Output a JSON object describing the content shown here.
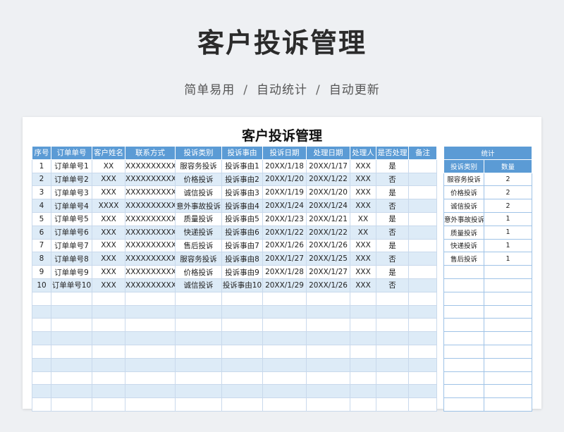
{
  "page": {
    "title": "客户投诉管理",
    "subtitle_parts": [
      "简单易用",
      "自动统计",
      "自动更新"
    ],
    "separator": "/"
  },
  "sheet": {
    "title": "客户投诉管理",
    "columns": [
      "序号",
      "订单单号",
      "客户姓名",
      "联系方式",
      "投诉类别",
      "投诉事由",
      "投诉日期",
      "处理日期",
      "处理人",
      "是否处理",
      "备注"
    ],
    "rows": [
      [
        "1",
        "订单单号1",
        "XX",
        "XXXXXXXXXX",
        "服容务投诉",
        "投诉事由1",
        "20XX/1/18",
        "20XX/1/17",
        "XXX",
        "是",
        ""
      ],
      [
        "2",
        "订单单号2",
        "XXX",
        "XXXXXXXXXX",
        "价格投诉",
        "投诉事由2",
        "20XX/1/20",
        "20XX/1/22",
        "XXX",
        "否",
        ""
      ],
      [
        "3",
        "订单单号3",
        "XXX",
        "XXXXXXXXXX",
        "诚信投诉",
        "投诉事由3",
        "20XX/1/19",
        "20XX/1/20",
        "XXX",
        "是",
        ""
      ],
      [
        "4",
        "订单单号4",
        "XXXX",
        "XXXXXXXXXX",
        "意外事故投诉",
        "投诉事由4",
        "20XX/1/24",
        "20XX/1/24",
        "XXX",
        "否",
        ""
      ],
      [
        "5",
        "订单单号5",
        "XXX",
        "XXXXXXXXXX",
        "质量投诉",
        "投诉事由5",
        "20XX/1/23",
        "20XX/1/21",
        "XX",
        "是",
        ""
      ],
      [
        "6",
        "订单单号6",
        "XXX",
        "XXXXXXXXXX",
        "快递投诉",
        "投诉事由6",
        "20XX/1/22",
        "20XX/1/22",
        "XX",
        "否",
        ""
      ],
      [
        "7",
        "订单单号7",
        "XXX",
        "XXXXXXXXXX",
        "售后投诉",
        "投诉事由7",
        "20XX/1/26",
        "20XX/1/26",
        "XXX",
        "是",
        ""
      ],
      [
        "8",
        "订单单号8",
        "XXX",
        "XXXXXXXXXX",
        "服容务投诉",
        "投诉事由8",
        "20XX/1/27",
        "20XX/1/25",
        "XXX",
        "否",
        ""
      ],
      [
        "9",
        "订单单号9",
        "XXX",
        "XXXXXXXXXX",
        "价格投诉",
        "投诉事由9",
        "20XX/1/28",
        "20XX/1/27",
        "XXX",
        "是",
        ""
      ],
      [
        "10",
        "订单单号10",
        "XXX",
        "XXXXXXXXXX",
        "诚信投诉",
        "投诉事由10",
        "20XX/1/29",
        "20XX/1/26",
        "XXX",
        "否",
        ""
      ]
    ],
    "empty_rows": 9
  },
  "stats": {
    "title": "统计",
    "columns": [
      "投诉类别",
      "数量"
    ],
    "rows": [
      [
        "服容务投诉",
        "2"
      ],
      [
        "价格投诉",
        "2"
      ],
      [
        "诚信投诉",
        "2"
      ],
      [
        "意外事故投诉",
        "1"
      ],
      [
        "质量投诉",
        "1"
      ],
      [
        "快递投诉",
        "1"
      ],
      [
        "售后投诉",
        "1"
      ]
    ],
    "empty_rows": 11
  },
  "colors": {
    "header": "#5b9bd5",
    "stripe": "#ddebf7",
    "background": "#eef0f3"
  }
}
